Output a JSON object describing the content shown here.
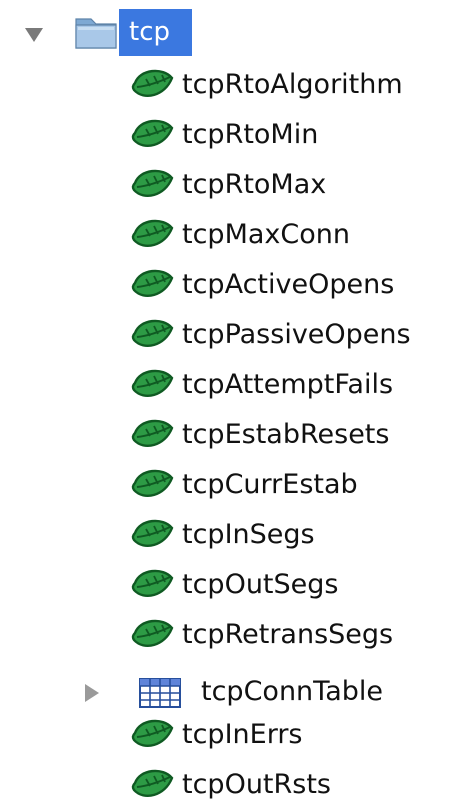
{
  "tree": {
    "root": {
      "label": "tcp",
      "icon": "folder-icon",
      "expanded": true
    },
    "children": [
      {
        "label": "tcpRtoAlgorithm",
        "icon": "leaf-icon"
      },
      {
        "label": "tcpRtoMin",
        "icon": "leaf-icon"
      },
      {
        "label": "tcpRtoMax",
        "icon": "leaf-icon"
      },
      {
        "label": "tcpMaxConn",
        "icon": "leaf-icon"
      },
      {
        "label": "tcpActiveOpens",
        "icon": "leaf-icon"
      },
      {
        "label": "tcpPassiveOpens",
        "icon": "leaf-icon"
      },
      {
        "label": "tcpAttemptFails",
        "icon": "leaf-icon"
      },
      {
        "label": "tcpEstabResets",
        "icon": "leaf-icon"
      },
      {
        "label": "tcpCurrEstab",
        "icon": "leaf-icon"
      },
      {
        "label": "tcpInSegs",
        "icon": "leaf-icon"
      },
      {
        "label": "tcpOutSegs",
        "icon": "leaf-icon"
      },
      {
        "label": "tcpRetransSegs",
        "icon": "leaf-icon"
      },
      {
        "label": "tcpConnTable",
        "icon": "table-icon",
        "expanded": false
      },
      {
        "label": "tcpInErrs",
        "icon": "leaf-icon"
      },
      {
        "label": "tcpOutRsts",
        "icon": "leaf-icon"
      }
    ]
  },
  "colors": {
    "selection": "#3b78e0",
    "leaf_dark": "#0f5a22",
    "leaf_light": "#2d9b45",
    "folder": "#8fb6db"
  }
}
